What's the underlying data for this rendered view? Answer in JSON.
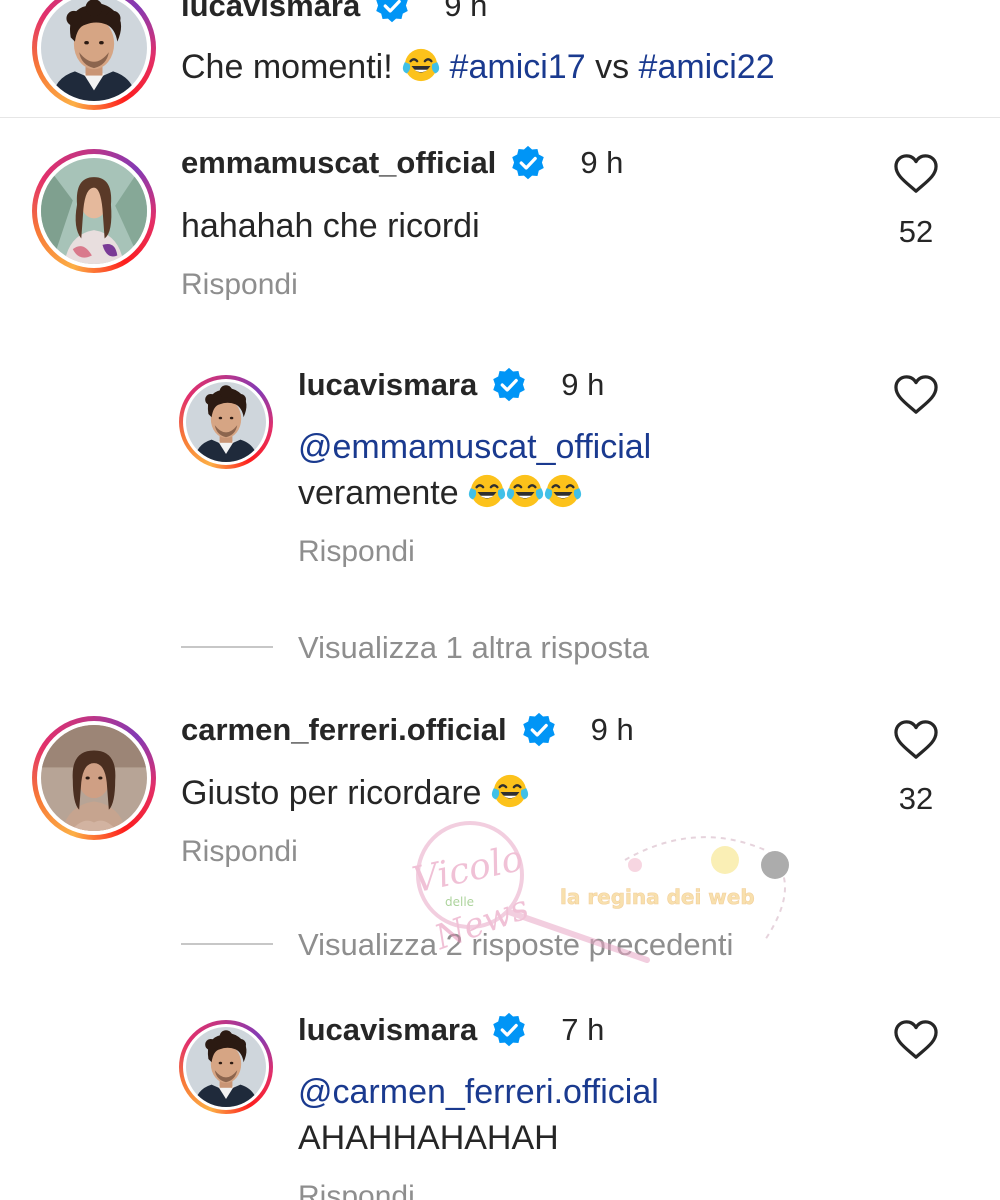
{
  "caption": {
    "username": "lucavismara",
    "time": "9 h",
    "text": "Che momenti! ",
    "emoji": "face-with-tears-of-joy",
    "tag1": "#amici17",
    "vs": " vs ",
    "tag2": "#amici22"
  },
  "comments": [
    {
      "username": "emmamuscat_official",
      "time": "9 h",
      "text": "hahahah che ricordi",
      "likes": "52",
      "reply_label": "Rispondi"
    },
    {
      "username": "lucavismara",
      "time": "9 h",
      "mention": "@emmamuscat_official",
      "text": "veramente ",
      "emoji": "face-with-tears-of-joy x3",
      "reply_label": "Rispondi"
    },
    {
      "username": "carmen_ferreri.official",
      "time": "9 h",
      "text": "Giusto per ricordare ",
      "emoji": "face-with-tears-of-joy",
      "likes": "32",
      "reply_label": "Rispondi"
    },
    {
      "username": "lucavismara",
      "time": "7 h",
      "mention": "@carmen_ferreri.official",
      "text": "AHAHHAHAHAH",
      "reply_label": "Rispondi"
    }
  ],
  "view_more": [
    "Visualizza 1 altra risposta",
    "Visualizza 2 risposte precedenti"
  ],
  "watermark": {
    "brand1": "Vicolo",
    "brand1_small": "delle",
    "brand1_end": "News",
    "brand2": "la regina dei web"
  },
  "colors": {
    "verified": "#0095f6",
    "hashtag": "#1a3a8f",
    "secondary_text": "#8e8e8e"
  }
}
